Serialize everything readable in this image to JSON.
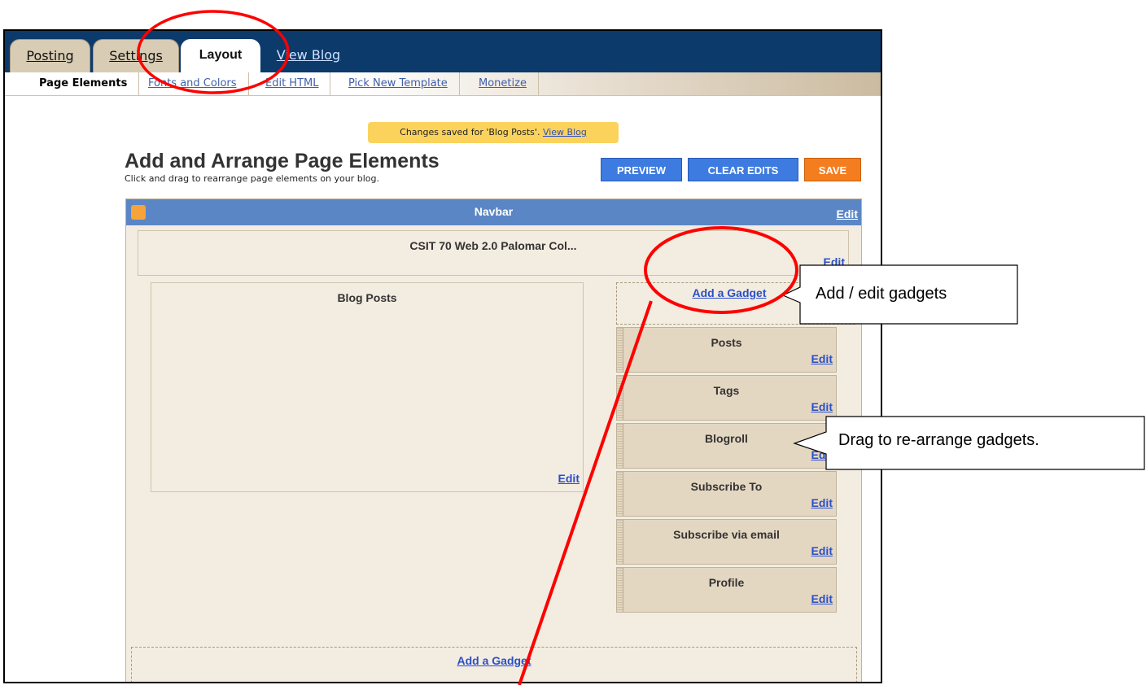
{
  "top_tabs": [
    {
      "label": "Posting",
      "state": "inactive"
    },
    {
      "label": "Settings",
      "state": "inactive"
    },
    {
      "label": "Layout",
      "state": "active"
    },
    {
      "label": "View Blog",
      "state": "link"
    }
  ],
  "sub_tabs": [
    {
      "label": "Page Elements",
      "state": "active"
    },
    {
      "label": "Fonts and Colors"
    },
    {
      "label": "Edit HTML"
    },
    {
      "label": "Pick New Template"
    },
    {
      "label": "Monetize"
    }
  ],
  "notice": {
    "text": "Changes saved for 'Blog Posts'. ",
    "link": "View Blog"
  },
  "heading": "Add and Arrange Page Elements",
  "subheading": "Click and drag to rearrange page elements on your blog.",
  "buttons": {
    "preview": "PREVIEW",
    "clear_edits": "CLEAR EDITS",
    "save": "SAVE"
  },
  "navbar": {
    "title": "Navbar",
    "edit": "Edit"
  },
  "header_box": {
    "title": "CSIT 70 Web 2.0 Palomar Col...",
    "edit": "Edit"
  },
  "blog_posts": {
    "title": "Blog Posts",
    "edit": "Edit"
  },
  "sidebar_add": "Add a Gadget",
  "gadgets": [
    {
      "title": "Posts",
      "edit": "Edit"
    },
    {
      "title": "Tags",
      "edit": "Edit"
    },
    {
      "title": "Blogroll",
      "edit": "Edit"
    },
    {
      "title": "Subscribe To",
      "edit": "Edit"
    },
    {
      "title": "Subscribe via email",
      "edit": "Edit"
    },
    {
      "title": "Profile",
      "edit": "Edit"
    }
  ],
  "footer_add": "Add a Gadget",
  "callouts": {
    "gadgets": "Add / edit gadgets",
    "drag": "Drag to re-arrange gadgets."
  },
  "colors": {
    "topbar": "#0b3a6b",
    "navbar": "#5b86c5",
    "panel": "#f3ece0",
    "gadget": "#e4d7c2",
    "annotation": "#ff0000",
    "link": "#2a4fc8"
  }
}
